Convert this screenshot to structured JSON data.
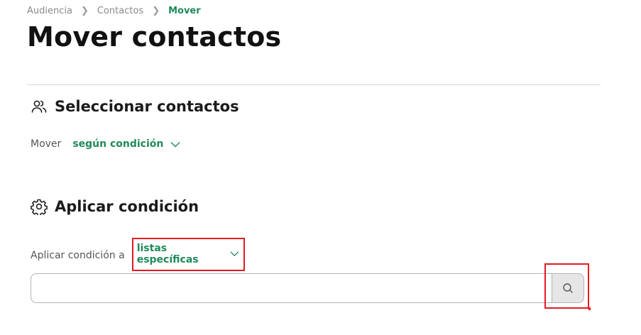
{
  "breadcrumb": {
    "items": [
      "Audiencia",
      "Contactos"
    ],
    "current": "Mover"
  },
  "page": {
    "title": "Mover contactos"
  },
  "select_section": {
    "title": "Seleccionar contactos",
    "icon": "users-icon",
    "label": "Mover",
    "dropdown_value": "según condición"
  },
  "condition_section": {
    "title": "Aplicar condición",
    "icon": "gear-icon",
    "label": "Aplicar condición a",
    "dropdown_value": "listas específicas"
  },
  "search": {
    "value": "",
    "placeholder": "",
    "button_icon": "search-icon"
  },
  "colors": {
    "accent": "#1f8a5b",
    "highlight": "#e31b23"
  }
}
